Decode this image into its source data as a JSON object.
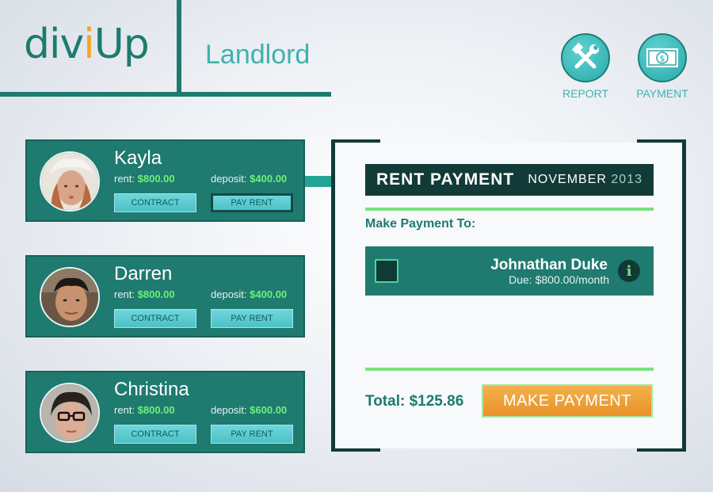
{
  "header": {
    "logo": {
      "part1": "div",
      "accent": "i",
      "part2": "Up"
    },
    "role": "Landlord",
    "report_label": "REPORT",
    "payment_label": "PAYMENT"
  },
  "tenants": [
    {
      "name": "Kayla",
      "rent_label": "rent:",
      "rent": "$800.00",
      "deposit_label": "deposit:",
      "deposit": "$400.00",
      "contract_label": "CONTRACT",
      "pay_label": "PAY RENT"
    },
    {
      "name": "Darren",
      "rent_label": "rent:",
      "rent": "$800.00",
      "deposit_label": "deposit:",
      "deposit": "$400.00",
      "contract_label": "CONTRACT",
      "pay_label": "PAY RENT"
    },
    {
      "name": "Christina",
      "rent_label": "rent:",
      "rent": "$800.00",
      "deposit_label": "deposit:",
      "deposit": "$600.00",
      "contract_label": "CONTRACT",
      "pay_label": "PAY RENT"
    }
  ],
  "payment": {
    "title": "RENT PAYMENT",
    "month": "NOVEMBER",
    "year": "2013",
    "make_to_label": "Make Payment To:",
    "payee_name": "Johnathan Duke",
    "payee_due": "Due: $800.00/month",
    "info_glyph": "i",
    "total": "Total: $125.86",
    "button_label": "MAKE PAYMENT"
  },
  "colors": {
    "primary": "#1f7a70",
    "accent_teal": "#3fb2ad",
    "highlight_green": "#6ff07a",
    "dark": "#123b37",
    "orange": "#f3a42b"
  },
  "icons": [
    "tools-icon",
    "money-icon",
    "info-icon",
    "checkbox"
  ]
}
